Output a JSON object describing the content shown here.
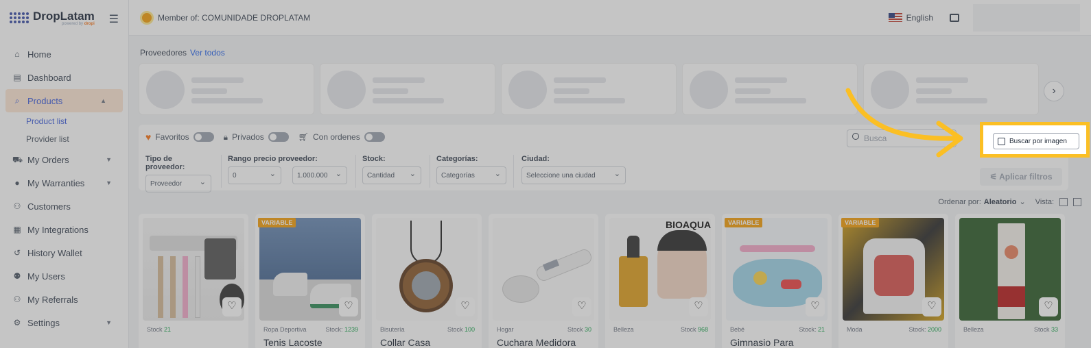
{
  "brand": {
    "name": "DropLatam",
    "sub_prefix": "powered by",
    "sub_brand": "dropi"
  },
  "topbar": {
    "member": "Member of: COMUNIDADE DROPLATAM",
    "language": "English"
  },
  "sidebar": {
    "items": [
      {
        "label": "Home",
        "icon": "home-icon"
      },
      {
        "label": "Dashboard",
        "icon": "dashboard-icon"
      },
      {
        "label": "Products",
        "icon": "search-icon"
      },
      {
        "label": "My Orders",
        "icon": "cart-icon"
      },
      {
        "label": "My Warranties",
        "icon": "shield-icon"
      },
      {
        "label": "Customers",
        "icon": "customers-icon"
      },
      {
        "label": "My Integrations",
        "icon": "integrations-icon"
      },
      {
        "label": "History Wallet",
        "icon": "history-icon"
      },
      {
        "label": "My Users",
        "icon": "users-icon"
      },
      {
        "label": "My Referrals",
        "icon": "referrals-icon"
      },
      {
        "label": "Settings",
        "icon": "gear-icon"
      }
    ],
    "sub_items": [
      "Product list",
      "Provider list"
    ]
  },
  "providers": {
    "title": "Proveedores",
    "link": "Ver todos"
  },
  "filters": {
    "favoritos": "Favoritos",
    "privados": "Privados",
    "con_ordenes": "Con ordenes",
    "search_placeholder": "Busca",
    "tipo_label": "Tipo de proveedor:",
    "tipo_value": "Proveedor",
    "rango_label": "Rango precio proveedor:",
    "rango_min": "0",
    "rango_max": "1.000.000",
    "stock_label": "Stock:",
    "stock_value": "Cantidad",
    "cat_label": "Categorías:",
    "cat_value": "Categorías",
    "ciudad_label": "Ciudad:",
    "ciudad_value": "Seleccione una ciudad",
    "apply": "Aplicar filtros"
  },
  "sort": {
    "label": "Ordenar por:",
    "value": "Aleatorio",
    "view_label": "Vista:"
  },
  "image_search": {
    "label": "Buscar por imagen"
  },
  "products": [
    {
      "category": "",
      "stock_label": "Stock",
      "stock": "21",
      "title": "",
      "variable": ""
    },
    {
      "category": "Ropa Deportiva",
      "stock_label": "Stock:",
      "stock": "1239",
      "title": "Tenis Lacoste",
      "variable": "VARIABLE"
    },
    {
      "category": "Bisutería",
      "stock_label": "Stock",
      "stock": "100",
      "title": "Collar Casa",
      "variable": ""
    },
    {
      "category": "Hogar",
      "stock_label": "Stock",
      "stock": "30",
      "title": "Cuchara Medidora",
      "variable": ""
    },
    {
      "category": "Belleza",
      "stock_label": "Stock",
      "stock": "968",
      "title": "",
      "variable": "",
      "brand_text": "BIOAQUA"
    },
    {
      "category": "Bebé",
      "stock_label": "Stock:",
      "stock": "21",
      "title": "Gimnasio Para",
      "variable": "VARIABLE"
    },
    {
      "category": "Moda",
      "stock_label": "Stock:",
      "stock": "2000",
      "title": "",
      "variable": "VARIABLE"
    },
    {
      "category": "Belleza",
      "stock_label": "Stock",
      "stock": "33",
      "title": "",
      "variable": ""
    }
  ]
}
